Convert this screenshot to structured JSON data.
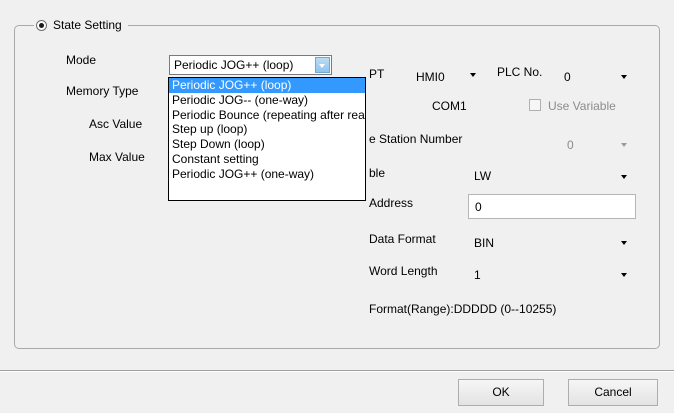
{
  "group": {
    "title": "State Setting"
  },
  "left": {
    "mode_label": "Mode",
    "memory_type_label": "Memory Type",
    "asc_value_label": "Asc Value",
    "max_value_label": "Max Value",
    "mode_selected": "Periodic JOG++ (loop)",
    "mode_options": [
      "Periodic JOG++ (loop)",
      "Periodic JOG-- (one-way)",
      "Periodic Bounce (repeating after reaching",
      "Step up (loop)",
      "Step Down (loop)",
      "Constant setting",
      "Periodic JOG++ (one-way)"
    ]
  },
  "right": {
    "pt_label": "PT",
    "pt_value": "HMI0",
    "plc_no_label": "PLC No.",
    "plc_no_value": "0",
    "com_value": "COM1",
    "use_variable_label": "Use Variable",
    "station_label": "e Station Number",
    "station_value": "0",
    "variable_label": "ble",
    "variable_value": "LW",
    "address_label": "Address",
    "address_value": "0",
    "data_format_label": "Data Format",
    "data_format_value": "BIN",
    "word_length_label": "Word Length",
    "word_length_value": "1",
    "format_range": "Format(Range):DDDDD (0--10255)"
  },
  "buttons": {
    "ok": "OK",
    "cancel": "Cancel"
  }
}
